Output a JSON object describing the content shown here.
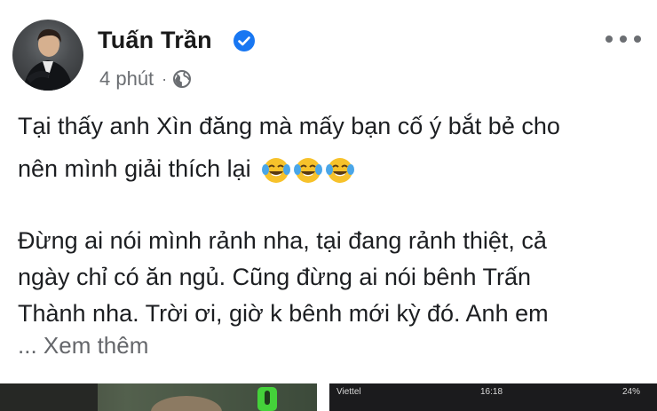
{
  "post": {
    "author": "Tuấn Trần",
    "time": "4 phút",
    "separator": "·",
    "lines": [
      "Tại thấy anh Xìn đăng mà mấy bạn cố ý bắt bẻ cho",
      "nên mình giải thích lại",
      "Đừng ai nói mình rảnh nha, tại đang rảnh thiệt, cả",
      "ngày chỉ có ăn ngủ. Cũng đừng ai nói bênh Trấn",
      "Thành nha. Trời ơi, giờ k bênh mới kỳ đó. Anh em"
    ],
    "see_more": "... Xem thêm",
    "emoji_names": [
      "face-with-tears-of-joy-icon",
      "face-with-tears-of-joy-icon",
      "face-with-tears-of-joy-icon"
    ]
  },
  "photos": {
    "right_carrier": "Viettel",
    "right_time": "16:18",
    "right_battery": "24%"
  },
  "colors": {
    "verified": "#1877f2",
    "text": "#1c1e21",
    "muted": "#65676b"
  }
}
